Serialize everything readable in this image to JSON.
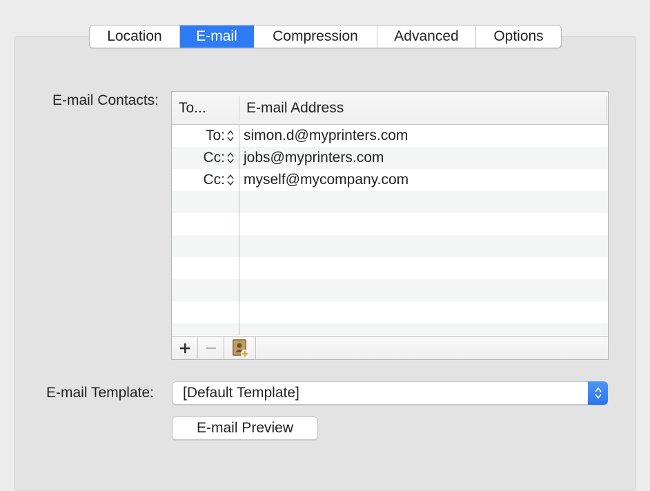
{
  "tabs": [
    {
      "label": "Location"
    },
    {
      "label": "E-mail"
    },
    {
      "label": "Compression"
    },
    {
      "label": "Advanced"
    },
    {
      "label": "Options"
    }
  ],
  "active_tab": "E-mail",
  "contacts": {
    "label": "E-mail Contacts:",
    "columns": {
      "to": "To...",
      "address": "E-mail Address"
    },
    "rows": [
      {
        "type": "To:",
        "address": "simon.d@myprinters.com"
      },
      {
        "type": "Cc:",
        "address": "jobs@myprinters.com"
      },
      {
        "type": "Cc:",
        "address": "myself@mycompany.com"
      }
    ],
    "toolbar": {
      "add_icon": "plus-icon",
      "remove_icon": "minus-icon",
      "address_book_icon": "address-book-add-icon"
    }
  },
  "template": {
    "label": "E-mail Template:",
    "selected": "[Default Template]"
  },
  "preview_button": {
    "label": "E-mail Preview"
  },
  "colors": {
    "accent": "#2d7cf5",
    "panel": "#e3e3e3",
    "background": "#ececec"
  }
}
